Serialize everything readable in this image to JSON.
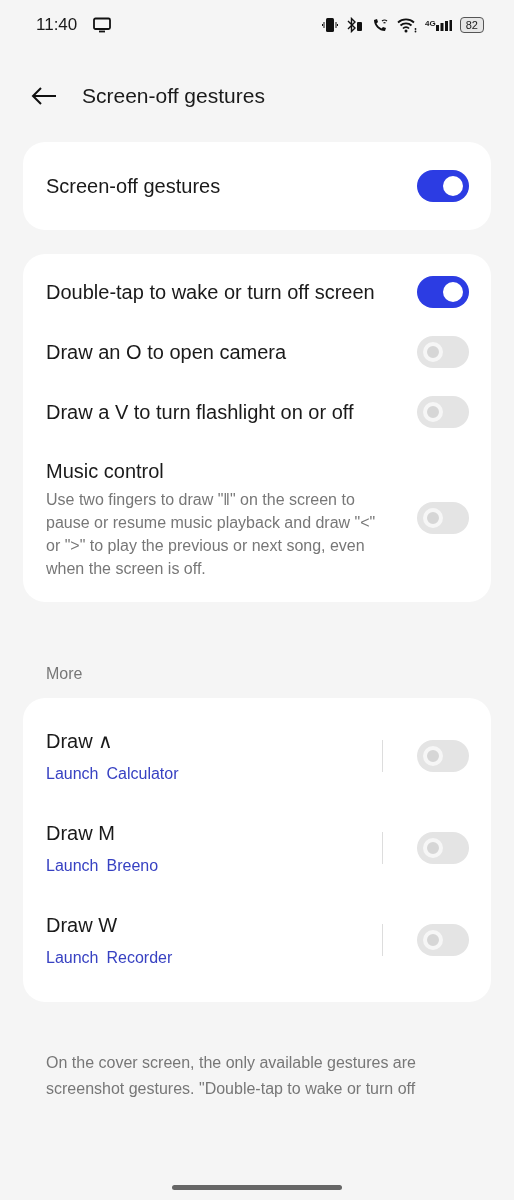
{
  "status_bar": {
    "time": "11:40",
    "network_type": "4G",
    "battery": "82"
  },
  "header": {
    "title": "Screen-off gestures"
  },
  "master": {
    "title": "Screen-off gestures",
    "on": true
  },
  "gestures": [
    {
      "title": "Double-tap to wake or turn off screen",
      "on": true
    },
    {
      "title": "Draw an O to open camera",
      "on": false
    },
    {
      "title": "Draw a V to turn flashlight on or off",
      "on": false
    },
    {
      "title": "Music control",
      "description": "Use two fingers to draw \"‖\" on the screen to pause or resume music playback and draw \"<\" or \">\" to play the previous or next song, even when the screen is off.",
      "on": false
    }
  ],
  "more_label": "More",
  "more": [
    {
      "title": "Draw ∧",
      "action": "Launch",
      "app": "Calculator",
      "on": false
    },
    {
      "title": "Draw M",
      "action": "Launch",
      "app": "Breeno",
      "on": false
    },
    {
      "title": "Draw W",
      "action": "Launch",
      "app": "Recorder",
      "on": false
    }
  ],
  "footer_note": "On the cover screen, the only available gestures are screenshot gestures. \"Double-tap to wake or turn off"
}
